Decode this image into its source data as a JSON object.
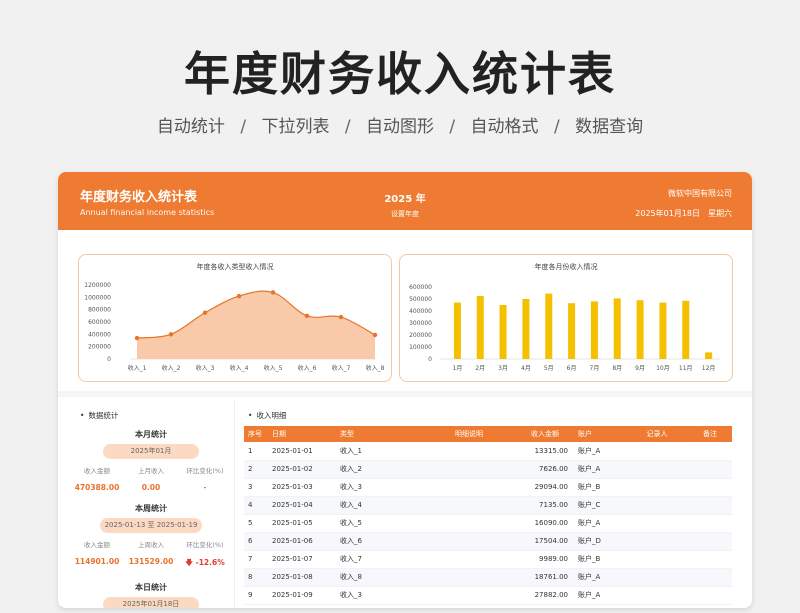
{
  "page": {
    "title": "年度财务收入统计表",
    "features": [
      "自动统计",
      "下拉列表",
      "自动图形",
      "自动格式",
      "数据查询"
    ],
    "separator": "/"
  },
  "header": {
    "title": "年度财务收入统计表",
    "subtitle": "Annual financial income statistics",
    "year": "2025 年",
    "year_label": "设置年度",
    "company": "微软中国有限公司",
    "date": "2025年01月18日　星期六"
  },
  "colors": {
    "accent": "#ee7b31",
    "bar": "#f5c000",
    "area": "#f7c4a0",
    "line": "#e8742a",
    "negative": "#e23b2e"
  },
  "chart_data": [
    {
      "type": "area",
      "title": "年度各收入类型收入情况",
      "categories": [
        "收入_1",
        "收入_2",
        "收入_3",
        "收入_4",
        "收入_5",
        "收入_6",
        "收入_7",
        "收入_8"
      ],
      "values": [
        340000,
        400000,
        750000,
        1020000,
        1080000,
        700000,
        680000,
        390000
      ],
      "ylim": [
        0,
        1200000
      ],
      "yticks": [
        "0",
        "200000",
        "400000",
        "600000",
        "800000",
        "1000000",
        "1200000"
      ],
      "grid": false
    },
    {
      "type": "bar",
      "title": "年度各月份收入情况",
      "categories": [
        "1月",
        "2月",
        "3月",
        "4月",
        "5月",
        "6月",
        "7月",
        "8月",
        "9月",
        "10月",
        "11月",
        "12月"
      ],
      "values": [
        470388,
        525000,
        450000,
        500000,
        545000,
        465000,
        480000,
        505000,
        490000,
        470000,
        485000,
        55000
      ],
      "ylim": [
        0,
        600000
      ],
      "yticks": [
        "0",
        "100000",
        "200000",
        "300000",
        "400000",
        "500000",
        "600000"
      ],
      "grid": false
    }
  ],
  "stats": {
    "section": "数据统计",
    "month": {
      "title": "本月统计",
      "period": "2025年01月",
      "labels": [
        "收入金额",
        "上月收入",
        "环比变化(%)"
      ],
      "values": [
        "470388.00",
        "0.00",
        "-"
      ]
    },
    "week": {
      "title": "本周统计",
      "period": "2025-01-13 至 2025-01-19",
      "labels": [
        "收入金额",
        "上周收入",
        "环比变化(%)"
      ],
      "values": [
        "114901.00",
        "131529.00",
        "-12.6%"
      ],
      "trend_icon": "down-arrow-icon"
    },
    "day": {
      "title": "本日统计",
      "period": "2025年01月18日"
    }
  },
  "detail": {
    "section": "收入明细",
    "columns": [
      "序号",
      "日期",
      "类型",
      "明细说明",
      "收入金额",
      "账户",
      "记录人",
      "备注"
    ],
    "rows": [
      [
        "1",
        "2025-01-01",
        "收入_1",
        "",
        "13315.00",
        "账户_A",
        "",
        ""
      ],
      [
        "2",
        "2025-01-02",
        "收入_2",
        "",
        "7626.00",
        "账户_A",
        "",
        ""
      ],
      [
        "3",
        "2025-01-03",
        "收入_3",
        "",
        "29094.00",
        "账户_B",
        "",
        ""
      ],
      [
        "4",
        "2025-01-04",
        "收入_4",
        "",
        "7135.00",
        "账户_C",
        "",
        ""
      ],
      [
        "5",
        "2025-01-05",
        "收入_5",
        "",
        "16090.00",
        "账户_A",
        "",
        ""
      ],
      [
        "6",
        "2025-01-06",
        "收入_6",
        "",
        "17504.00",
        "账户_D",
        "",
        ""
      ],
      [
        "7",
        "2025-01-07",
        "收入_7",
        "",
        "9989.00",
        "账户_B",
        "",
        ""
      ],
      [
        "8",
        "2025-01-08",
        "收入_8",
        "",
        "18761.00",
        "账户_A",
        "",
        ""
      ],
      [
        "9",
        "2025-01-09",
        "收入_3",
        "",
        "27882.00",
        "账户_A",
        "",
        ""
      ]
    ]
  }
}
